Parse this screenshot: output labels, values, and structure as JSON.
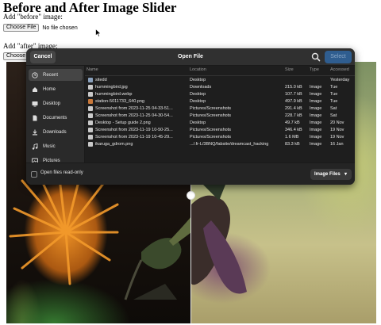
{
  "page": {
    "title": "Before and After Image Slider",
    "before_label": "Add \"before\" image:",
    "after_label": "Add \"after\" image:",
    "choose_file_label": "Choose File",
    "no_file_text": "No file chosen",
    "choose_file_truncated": "Choose F"
  },
  "dialog": {
    "title": "Open File",
    "cancel_label": "Cancel",
    "select_label": "Select",
    "search_icon": "search-icon",
    "sidebar": [
      {
        "label": "Recent",
        "icon": "clock-icon",
        "active": true
      },
      {
        "label": "Home",
        "icon": "home-icon",
        "active": false
      },
      {
        "label": "Desktop",
        "icon": "desktop-icon",
        "active": false
      },
      {
        "label": "Documents",
        "icon": "documents-icon",
        "active": false
      },
      {
        "label": "Downloads",
        "icon": "download-icon",
        "active": false
      },
      {
        "label": "Music",
        "icon": "music-icon",
        "active": false
      },
      {
        "label": "Pictures",
        "icon": "pictures-icon",
        "active": false
      }
    ],
    "columns": {
      "name": "Name",
      "location": "Location",
      "size": "Size",
      "type": "Type",
      "accessed": "Accessed"
    },
    "files": [
      {
        "name": "sitedd",
        "location": "Desktop",
        "size": "",
        "type": "",
        "accessed": "Yesterday",
        "icon": "folder-icon"
      },
      {
        "name": "hummingbird.jpg",
        "location": "Downloads",
        "size": "215.0 kB",
        "type": "Image",
        "accessed": "Tue",
        "icon": "image-file-icon"
      },
      {
        "name": "hummingbird.webp",
        "location": "Desktop",
        "size": "107.7 kB",
        "type": "Image",
        "accessed": "Tue",
        "icon": "image-file-icon"
      },
      {
        "name": "station-5011733_640.png",
        "location": "Desktop",
        "size": "497.9 kB",
        "type": "Image",
        "accessed": "Tue",
        "icon": "image-thumb-icon"
      },
      {
        "name": "Screenshot from 2023-11-25 04-33-51...",
        "location": "Pictures/Screenshots",
        "size": "291.4 kB",
        "type": "Image",
        "accessed": "Sat",
        "icon": "image-file-icon"
      },
      {
        "name": "Screenshot from 2023-11-25 04-30-54...",
        "location": "Pictures/Screenshots",
        "size": "228.7 kB",
        "type": "Image",
        "accessed": "Sat",
        "icon": "image-file-icon"
      },
      {
        "name": "Desktop - Setup guide 2.png",
        "location": "Desktop",
        "size": "49.7 kB",
        "type": "Image",
        "accessed": "20 Nov",
        "icon": "image-file-icon"
      },
      {
        "name": "Screenshot from 2023-11-19 10-50-25...",
        "location": "Pictures/Screenshots",
        "size": "346.4 kB",
        "type": "Image",
        "accessed": "19 Nov",
        "icon": "image-file-icon"
      },
      {
        "name": "Screenshot from 2023-11-19 10-45-29...",
        "location": "Pictures/Screenshots",
        "size": "1.6 MB",
        "type": "Image",
        "accessed": "19 Nov",
        "icon": "image-file-icon"
      },
      {
        "name": "ikaruga_gdrom.png",
        "location": ".../.fr-L/3BNQ/fabsite/dreamcast_hacking",
        "size": "83.3 kB",
        "type": "Image",
        "accessed": "16 Jan",
        "icon": "image-file-icon"
      }
    ],
    "read_only_label": "Open files read-only",
    "filter_label": "Image Files"
  }
}
